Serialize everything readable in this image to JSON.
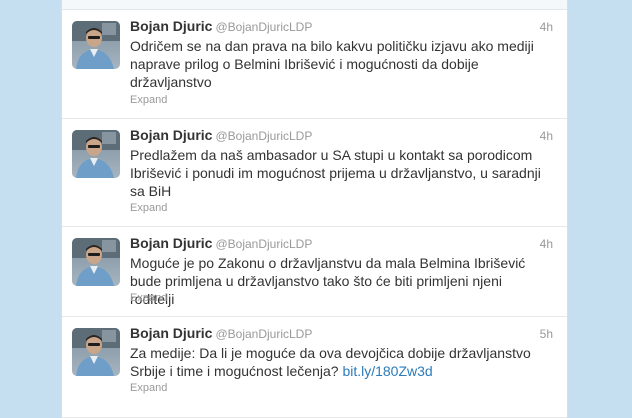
{
  "tweets": [
    {
      "name": "Bojan Djuric",
      "handle": "@BojanDjuricLDP",
      "time": "4h",
      "text": "Odričem se na dan prava na bilo kakvu političku izjavu ako mediji naprave prilog o Belmini Ibrišević i mogućnosti da dobije državljanstvo",
      "expand": "Expand"
    },
    {
      "name": "Bojan Djuric",
      "handle": "@BojanDjuricLDP",
      "time": "4h",
      "text": "Predlažem da naš ambasador u SA stupi u kontakt sa porodicom Ibrišević i ponudi im mogućnost prijema u državljanstvo, u saradnji sa BiH",
      "expand": "Expand"
    },
    {
      "name": "Bojan Djuric",
      "handle": "@BojanDjuricLDP",
      "time": "4h",
      "text": "Moguće je po Zakonu o državljanstvu da mala Belmina Ibrišević bude primljena u državljanstvo tako što će biti primljeni njeni roditelji",
      "expand": "Expand"
    },
    {
      "name": "Bojan Djuric",
      "handle": "@BojanDjuricLDP",
      "time": "5h",
      "text": "Za medije: Da li je moguće da ova devojčica dobije državljanstvo Srbije i time i mogućnost lečenja?",
      "link": "bit.ly/180Zw3d",
      "expand": "Expand"
    }
  ],
  "colors": {
    "page_background": "#c5def0",
    "stream_background": "#ffffff",
    "primary_text": "#333333",
    "secondary_text": "#999999",
    "link": "#2b7bb9"
  }
}
